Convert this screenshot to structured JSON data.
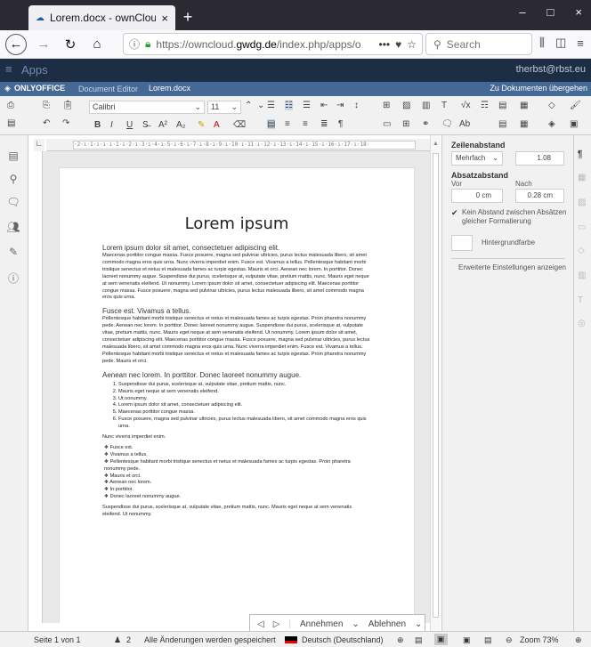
{
  "browser": {
    "tab_title": "Lorem.docx - ownCloud",
    "url_prefix": "https://owncloud.",
    "url_domain": "gwdg.de",
    "url_suffix": "/index.php/apps/o",
    "search_placeholder": "Search"
  },
  "owncloud": {
    "apps_label": "Apps",
    "user": "therbst@rbst.eu"
  },
  "onlyoffice": {
    "brand": "ONLYOFFICE",
    "editor_label": "Document Editor",
    "file_name": "Lorem.docx",
    "back_link": "Zu Dokumenten übergehen"
  },
  "toolbar": {
    "font_name": "Calibri",
    "font_size": "11"
  },
  "document": {
    "title": "Lorem ipsum",
    "heading1": "Lorem ipsum dolor sit amet, consectetuer adipiscing elit.",
    "para1": "Maecenas porttitor congue massa. Fusce posuere, magna sed pulvinar ultricies, purus lectus malesuada libero, sit amet commodo magna eros quis urna. Nunc viverra imperdiet enim. Fusce est. Vivamus a tellus. Pellentesque habitant morbi tristique senectus et netus et malesuada fames ac turpis egestas. Mauris et orci. Aenean nec lorem. In porttitor. Donec laoreet nonummy augue. Suspendisse dui purus, scelerisque at, vulputate vitae, pretium mattis, nunc. Mauris eget neque at sem venenatis eleifend. Ut nonummy. Lorem ipsum dolor sit amet, consectetuer adipiscing elit. Maecenas porttitor congue massa. Fusce posuere, magna sed pulvinar ultricies, purus lectus malesuada libero, sit amet commodo magna eros quis urna.",
    "heading2": "Fusce est. Vivamus a tellus.",
    "para2": "Pellentesque habitant morbi tristique senectus et netus et malesuada fames ac turpis egestas. Proin pharetra nonummy pede. Aenean nec lorem. In porttitor. Donec laoreet nonummy augue. Suspendisse dui purus, scelerisque at, vulputate vitae, pretium mattis, nunc. Mauris eget neque at sem venenatis eleifend. Ut nonummy. Lorem ipsum dolor sit amet, consectetuer adipiscing elit. Maecenas porttitor congue massa. Fusce posuere, magna sed pulvinar ultricies, purus lectus malesuada libero, sit amet commodo magna eros quis urna. Nunc viverra imperdiet enim. Fusce est. Vivamus a tellus. Pellentesque habitant morbi tristique senectus et netus et malesuada fames ac turpis egestas. Proin pharetra nonummy pede. Mauris et orci.",
    "heading3": "Aenean nec lorem. In porttitor. Donec laoreet nonummy augue.",
    "ordered": [
      "Suspendisse dui purus, scelerisque at, vulputate vitae, pretium mattis, nunc.",
      "Mauris eget neque at sem venenatis eleifend.",
      "Ut nonummy.",
      "Lorem ipsum dolor sit amet, consectetuer adipiscing elit.",
      "Maecenas porttitor congue massa.",
      "Fusce posuere, magna sed pulvinar ultricies, purus lectus malesuada libero, sit amet commodo magna eros quis urna."
    ],
    "para3": "Nunc viverra imperdiet enim.",
    "bullets": [
      "Fusce est.",
      "Vivamus a tellus.",
      "Pellentesque habitant morbi tristique senectus et netus et malesuada fames ac turpis egestas. Proin pharetra nonummy pede.",
      "Mauris et orci.",
      "Aenean nec lorem.",
      "In porttitor.",
      "Donec laoreet nonummy augue."
    ],
    "para4": "Suspendisse dui purus, scelerisque at, vulputate vitae, pretium mattis, nunc. Mauris eget neque at sem venenatis eleifend. Ut nonummy."
  },
  "ruler_text": "·2·ı·1·ı·ı·ı·1·ı·2·ı·3·ı·4·ı·5·ı·6·ı·7·ı·8·ı·9·ı·10·ı·11·ı·12·ı·13·ı·14·ı·15·ı·16·ı·17·ı·18·",
  "review": {
    "accept": "Annehmen",
    "reject": "Ablehnen"
  },
  "panel": {
    "line_spacing_label": "Zeilenabstand",
    "line_spacing_mode": "Mehrfach",
    "line_spacing_value": "1.08",
    "para_spacing_label": "Absatzabstand",
    "before_label": "Vor",
    "after_label": "Nach",
    "before_value": "0 cm",
    "after_value": "0.28 cm",
    "no_spacing_label": "Kein Abstand zwischen Absätzen gleicher Formatierung",
    "bg_color_label": "Hintergrundfarbe",
    "advanced_link": "Erweiterte Einstellungen anzeigen"
  },
  "status": {
    "page": "Seite 1 von 1",
    "users": "2",
    "saved": "Alle Änderungen werden gespeichert",
    "language": "Deutsch (Deutschland)",
    "zoom": "Zoom 73%"
  }
}
